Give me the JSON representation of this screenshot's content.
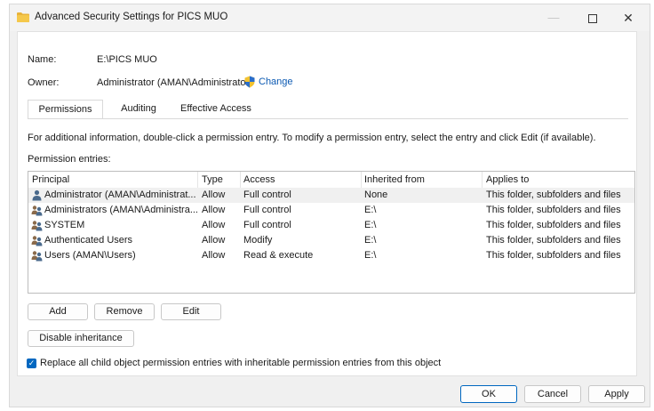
{
  "window": {
    "title": "Advanced Security Settings for PICS MUO",
    "minimize_glyph": "—",
    "close_glyph": "✕"
  },
  "info": {
    "name_label": "Name:",
    "name_value": "E:\\PICS MUO",
    "owner_label": "Owner:",
    "owner_value": "Administrator (AMAN\\Administrator)",
    "change_label": "Change"
  },
  "tabs": [
    {
      "label": "Permissions",
      "active": true
    },
    {
      "label": "Auditing",
      "active": false
    },
    {
      "label": "Effective Access",
      "active": false
    }
  ],
  "description": "For additional information, double-click a permission entry. To modify a permission entry, select the entry and click Edit (if available).",
  "entries_label": "Permission entries:",
  "table": {
    "columns": [
      "Principal",
      "Type",
      "Access",
      "Inherited from",
      "Applies to"
    ],
    "rows": [
      {
        "principal": "Administrator (AMAN\\Administrat...",
        "type": "Allow",
        "access": "Full control",
        "inherited": "None",
        "applies": "This folder, subfolders and files",
        "icon": "user-icon",
        "selected": true
      },
      {
        "principal": "Administrators (AMAN\\Administra...",
        "type": "Allow",
        "access": "Full control",
        "inherited": "E:\\",
        "applies": "This folder, subfolders and files",
        "icon": "group-icon",
        "selected": false
      },
      {
        "principal": "SYSTEM",
        "type": "Allow",
        "access": "Full control",
        "inherited": "E:\\",
        "applies": "This folder, subfolders and files",
        "icon": "group-icon",
        "selected": false
      },
      {
        "principal": "Authenticated Users",
        "type": "Allow",
        "access": "Modify",
        "inherited": "E:\\",
        "applies": "This folder, subfolders and files",
        "icon": "group-icon",
        "selected": false
      },
      {
        "principal": "Users (AMAN\\Users)",
        "type": "Allow",
        "access": "Read & execute",
        "inherited": "E:\\",
        "applies": "This folder, subfolders and files",
        "icon": "group-icon",
        "selected": false
      }
    ]
  },
  "buttons": {
    "add": "Add",
    "remove": "Remove",
    "edit": "Edit",
    "disable_inheritance": "Disable inheritance",
    "ok": "OK",
    "cancel": "Cancel",
    "apply": "Apply"
  },
  "replace_checkbox": {
    "label": "Replace all child object permission entries with inheritable permission entries from this object",
    "checked": true
  },
  "colors": {
    "accent": "#0067c0",
    "link": "#0b59b2",
    "folder": "#e8b33a"
  }
}
